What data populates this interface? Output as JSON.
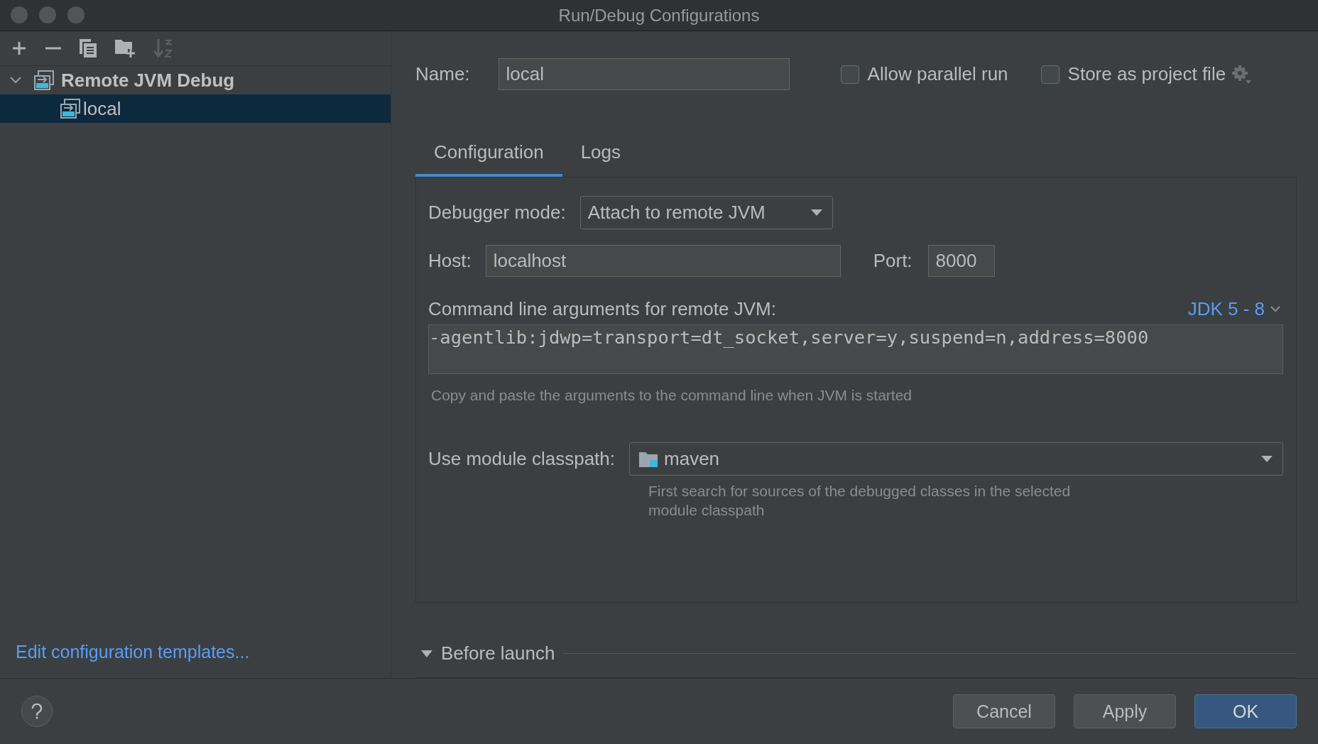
{
  "window": {
    "title": "Run/Debug Configurations"
  },
  "toolbar": [
    {
      "kind": "add",
      "disabled": false
    },
    {
      "kind": "remove",
      "disabled": false
    },
    {
      "kind": "copy",
      "disabled": false
    },
    {
      "kind": "folder",
      "disabled": false
    },
    {
      "kind": "sort",
      "disabled": true
    }
  ],
  "tree": [
    {
      "label": "Remote JVM Debug",
      "expanded": true,
      "selected": false,
      "children": [
        {
          "label": "local",
          "selected": true
        }
      ]
    }
  ],
  "templates_link": "Edit configuration templates...",
  "name": {
    "label": "Name:",
    "value": "local"
  },
  "options": [
    {
      "label": "Allow parallel run",
      "checked": false
    },
    {
      "label": "Store as project file",
      "checked": false
    }
  ],
  "tabs": [
    {
      "label": "Configuration",
      "selected": true
    },
    {
      "label": "Logs",
      "selected": false
    }
  ],
  "debugger_mode": {
    "label": "Debugger mode:",
    "value": "Attach to remote JVM"
  },
  "host": {
    "label": "Host:",
    "value": "localhost"
  },
  "port": {
    "label": "Port:",
    "value": "8000"
  },
  "command_line": {
    "label": "Command line arguments for remote JVM:",
    "jdk": "JDK 5 - 8",
    "value": "-agentlib:jdwp=transport=dt_socket,server=y,suspend=n,address=8000",
    "hint": "Copy and paste the arguments to the command line when JVM is started"
  },
  "classpath": {
    "label": "Use module classpath:",
    "value": "maven",
    "hint": "First search for sources of the debugged classes in the selected module classpath"
  },
  "before_launch": {
    "label": "Before launch",
    "expanded": true
  },
  "buttons": [
    {
      "label": "Cancel",
      "kind": "secondary"
    },
    {
      "label": "Apply",
      "kind": "secondary"
    },
    {
      "label": "OK",
      "kind": "primary"
    }
  ]
}
